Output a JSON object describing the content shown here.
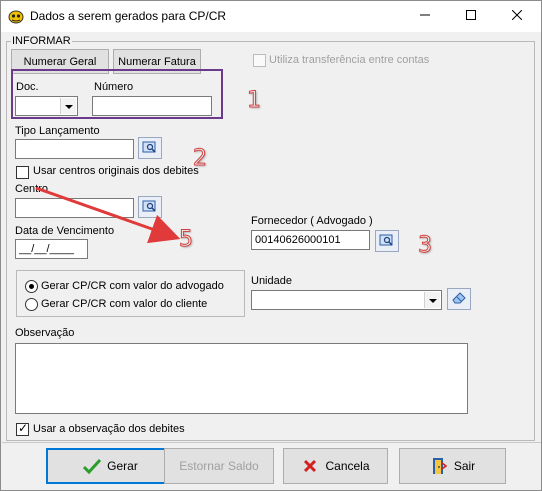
{
  "window": {
    "title": "Dados a serem gerados para CP/CR",
    "controls": {
      "minimize_icon": "minimize-icon",
      "maximize_icon": "maximize-icon",
      "close_icon": "close-icon"
    }
  },
  "group": {
    "label": "INFORMAR"
  },
  "buttons": {
    "numerar_geral": "Numerar Geral",
    "numerar_fatura": "Numerar Fatura"
  },
  "transfer_checkbox": {
    "label": "Utiliza transferência entre contas",
    "checked": false,
    "enabled": false
  },
  "doc": {
    "label": "Doc.",
    "value": ""
  },
  "numero": {
    "label": "Número",
    "value": ""
  },
  "tipo_lancamento": {
    "label": "Tipo Lançamento",
    "value": ""
  },
  "usar_centros": {
    "label": "Usar centros originais dos debites",
    "checked": false
  },
  "centro": {
    "label": "Centro",
    "value": ""
  },
  "data_vencimento": {
    "label": "Data de Vencimento",
    "value": "__/__/____"
  },
  "fornecedor": {
    "label": "Fornecedor ( Advogado )",
    "value": "00140626000101"
  },
  "radio": {
    "option_advogado": "Gerar CP/CR com valor do advogado",
    "option_cliente": "Gerar CP/CR com valor do cliente",
    "selected": "advogado"
  },
  "unidade": {
    "label": "Unidade",
    "value": ""
  },
  "observacao": {
    "label": "Observação",
    "value": ""
  },
  "usar_observacao": {
    "label": "Usar a observação dos debites",
    "checked": true
  },
  "footer": {
    "gerar": "Gerar",
    "estornar": "Estornar Saldo",
    "cancela": "Cancela",
    "sair": "Sair"
  },
  "annotations": [
    "1",
    "2",
    "3",
    "5"
  ],
  "colors": {
    "annotation_box": "#6b3a8a",
    "annotation_arrow": "#e03a3a",
    "annotation_number": "#d04040",
    "accent": "#0078d7"
  }
}
